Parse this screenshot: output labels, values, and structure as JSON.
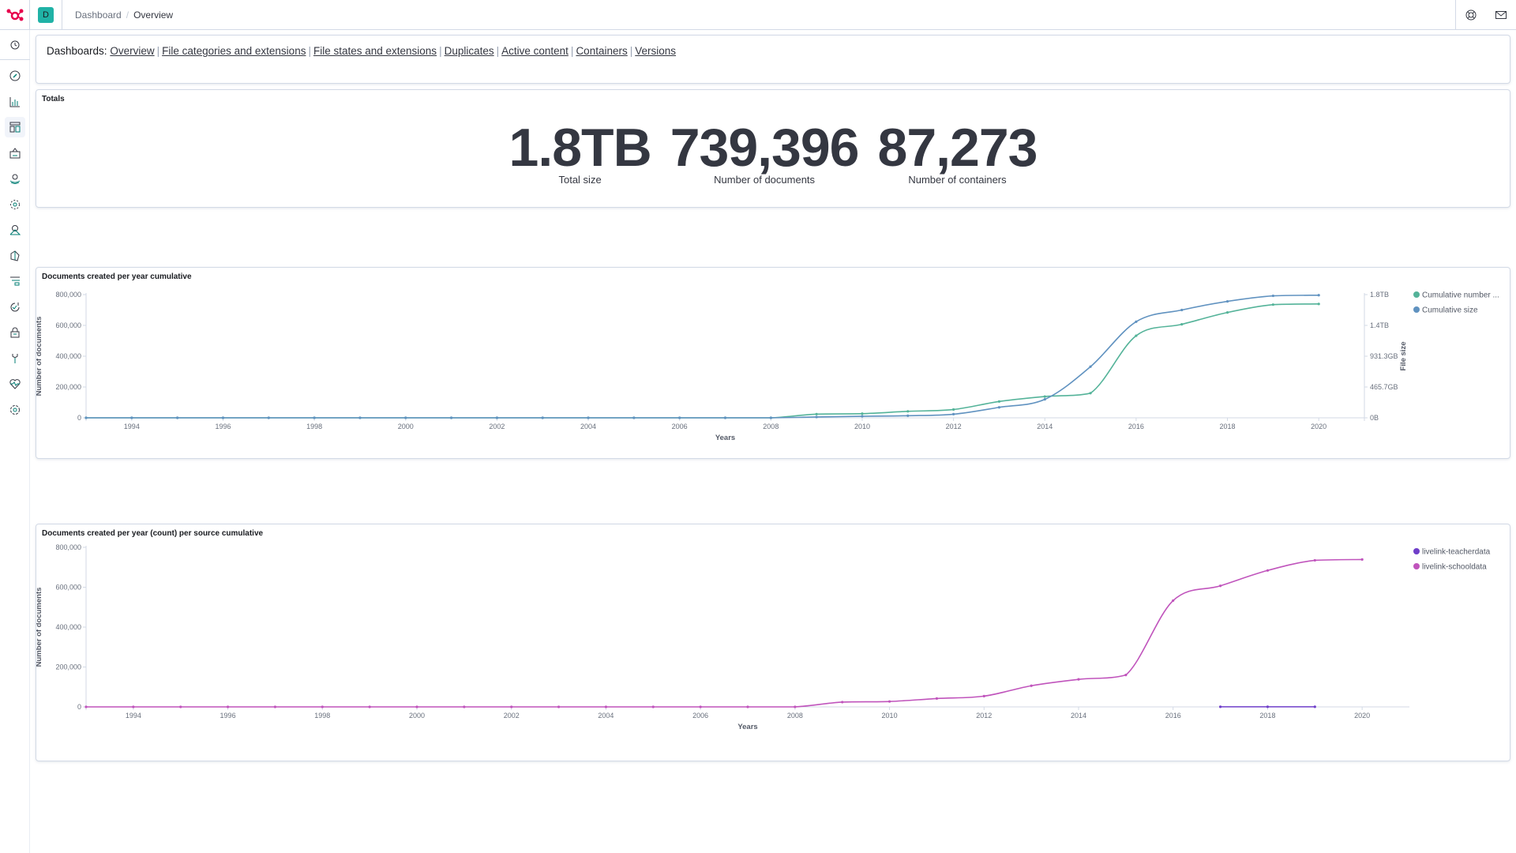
{
  "header": {
    "space_initial": "D",
    "breadcrumbs": [
      "Dashboard",
      "Overview"
    ],
    "breadcrumb_separator": "/",
    "icons": [
      "help-icon",
      "mail-icon"
    ]
  },
  "sidebar": {
    "items": [
      {
        "name": "recently-viewed",
        "icon": "clock-icon"
      },
      {
        "name": "discover",
        "icon": "compass-icon"
      },
      {
        "name": "visualize",
        "icon": "chart-icon"
      },
      {
        "name": "dashboard",
        "icon": "dashboard-icon",
        "active": true
      },
      {
        "name": "canvas",
        "icon": "canvas-icon"
      },
      {
        "name": "maps",
        "icon": "map-pin-icon"
      },
      {
        "name": "ml",
        "icon": "ml-icon"
      },
      {
        "name": "infrastructure",
        "icon": "infra-icon"
      },
      {
        "name": "logs",
        "icon": "logs-icon"
      },
      {
        "name": "apm",
        "icon": "apm-icon"
      },
      {
        "name": "uptime",
        "icon": "uptime-icon"
      },
      {
        "name": "siem",
        "icon": "lock-icon"
      },
      {
        "name": "dev-tools",
        "icon": "wrench-icon"
      },
      {
        "name": "monitoring",
        "icon": "heartbeat-icon"
      },
      {
        "name": "management",
        "icon": "gear-icon"
      }
    ]
  },
  "links_panel": {
    "label": "Dashboards:",
    "links": [
      "Overview",
      "File categories and extensions",
      "File states and extensions",
      "Duplicates",
      "Active content",
      "Containers",
      "Versions"
    ],
    "separator": "|"
  },
  "totals": {
    "title": "Totals",
    "metrics": [
      {
        "value": "1.8TB",
        "label": "Total size"
      },
      {
        "value": "739,396",
        "label": "Number of documents"
      },
      {
        "value": "87,273",
        "label": "Number of containers"
      }
    ]
  },
  "chart_data": [
    {
      "type": "line",
      "title": "Documents created per year cumulative",
      "xlabel": "Years",
      "ylabel": "Number of documents",
      "y2label": "File size",
      "x": [
        1993,
        1994,
        1995,
        1996,
        1997,
        1998,
        1999,
        2000,
        2001,
        2002,
        2003,
        2004,
        2005,
        2006,
        2007,
        2008,
        2009,
        2010,
        2011,
        2012,
        2013,
        2014,
        2015,
        2016,
        2017,
        2018,
        2019,
        2020
      ],
      "xlim": [
        1993,
        2021
      ],
      "x_ticks": [
        "1994",
        "1996",
        "1998",
        "2000",
        "2002",
        "2004",
        "2006",
        "2008",
        "2010",
        "2012",
        "2014",
        "2016",
        "2018",
        "2020"
      ],
      "ylim": [
        0,
        800000
      ],
      "y_ticks": [
        "0",
        "200,000",
        "400,000",
        "600,000",
        "800,000"
      ],
      "y2lim_bytes": [
        0,
        2000000000000
      ],
      "y2_ticks": [
        "0B",
        "465.7GB",
        "931.3GB",
        "1.4TB",
        "1.8TB"
      ],
      "legend_position": "top-right",
      "grid": false,
      "series": [
        {
          "name": "Cumulative number ...",
          "axis": "left",
          "color": "#54b399",
          "values": [
            0,
            0,
            0,
            0,
            0,
            0,
            0,
            0,
            0,
            0,
            0,
            0,
            0,
            0,
            0,
            0,
            24000,
            27000,
            42000,
            54000,
            106000,
            138000,
            160000,
            533000,
            607000,
            684000,
            735000,
            739396
          ]
        },
        {
          "name": "Cumulative size",
          "axis": "right",
          "color": "#6092c0",
          "values": [
            0,
            0,
            0,
            0,
            0,
            0,
            0,
            0,
            0,
            0,
            0,
            0,
            0,
            0,
            0,
            0,
            13000000000,
            25000000000,
            34000000000,
            59000000000,
            170000000000,
            300000000000,
            830000000000,
            1560000000000,
            1750000000000,
            1890000000000,
            1980000000000,
            1990000000000
          ]
        }
      ]
    },
    {
      "type": "line",
      "title": "Documents created per year (count) per source cumulative",
      "xlabel": "Years",
      "ylabel": "Number of documents",
      "x": [
        1993,
        1994,
        1995,
        1996,
        1997,
        1998,
        1999,
        2000,
        2001,
        2002,
        2003,
        2004,
        2005,
        2006,
        2007,
        2008,
        2009,
        2010,
        2011,
        2012,
        2013,
        2014,
        2015,
        2016,
        2017,
        2018,
        2019,
        2020
      ],
      "xlim": [
        1993,
        2021
      ],
      "x_ticks": [
        "1994",
        "1996",
        "1998",
        "2000",
        "2002",
        "2004",
        "2006",
        "2008",
        "2010",
        "2012",
        "2014",
        "2016",
        "2018",
        "2020"
      ],
      "ylim": [
        0,
        800000
      ],
      "y_ticks": [
        "0",
        "200,000",
        "400,000",
        "600,000",
        "800,000"
      ],
      "legend_position": "top-right",
      "grid": false,
      "series": [
        {
          "name": "livelink-teacherdata",
          "color": "#6f3fc9",
          "x": [
            2017,
            2018,
            2019
          ],
          "values": [
            500,
            500,
            500
          ]
        },
        {
          "name": "livelink-schooldata",
          "color": "#c054bc",
          "values": [
            0,
            0,
            0,
            0,
            0,
            0,
            0,
            0,
            0,
            0,
            0,
            0,
            0,
            0,
            0,
            0,
            24000,
            27000,
            42000,
            54000,
            106000,
            138000,
            160000,
            533000,
            607000,
            684000,
            735000,
            739000
          ]
        }
      ]
    }
  ]
}
